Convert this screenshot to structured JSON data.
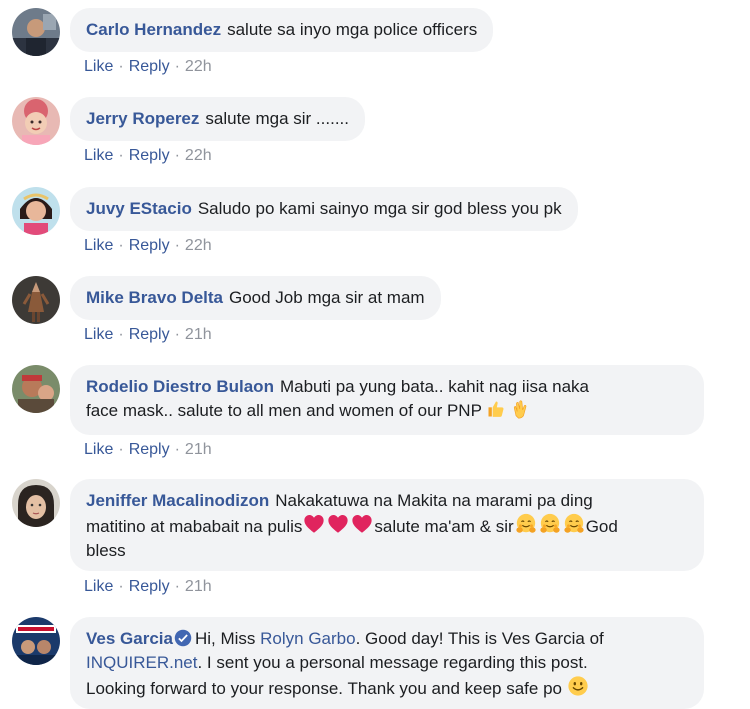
{
  "comments": [
    {
      "name": "Carlo Hernandez",
      "text": "salute sa inyo mga police officers",
      "like": "Like",
      "reply": "Reply",
      "time": "22h"
    },
    {
      "name": "Jerry Roperez",
      "text": "salute mga sir .......",
      "like": "Like",
      "reply": "Reply",
      "time": "22h"
    },
    {
      "name": "Juvy EStacio",
      "text": "Saludo po kami sainyo mga sir god bless you pk",
      "like": "Like",
      "reply": "Reply",
      "time": "22h"
    },
    {
      "name": "Mike Bravo Delta",
      "text": "Good Job mga sir at mam",
      "like": "Like",
      "reply": "Reply",
      "time": "21h"
    },
    {
      "name": "Rodelio Diestro Bulaon",
      "text_line1": "Mabuti pa yung bata.. kahit nag iisa naka",
      "text_line2": "face mask.. salute to all men and women of our PNP",
      "emojis": [
        "thumbs-up-icon",
        "clapping-hands-icon"
      ],
      "like": "Like",
      "reply": "Reply",
      "time": "21h"
    },
    {
      "name": "Jeniffer Macalinodizon",
      "text_line1": "Nakakatuwa na Makita na marami pa ding",
      "text_line2a": "matitino at mababait na pulis",
      "text_line2b": "salute ma'am & sir",
      "text_line2c": "God",
      "text_line3": "bless",
      "emojis": [
        "red-heart-icon",
        "hugging-face-icon"
      ],
      "like": "Like",
      "reply": "Reply",
      "time": "21h"
    },
    {
      "name": "Ves Garcia",
      "verified": true,
      "text_a": "Hi, Miss ",
      "mention": "Rolyn Garbo",
      "text_b": ". Good day! This is Ves Garcia of",
      "link": "INQUIRER.net",
      "text_c": ". I sent you a personal message regarding this post.",
      "text_d": "Looking forward to your response. Thank you and keep safe po",
      "emojis": [
        "smiling-face-icon"
      ]
    }
  ],
  "colors": {
    "name": "#385898",
    "bubble": "#f2f3f5",
    "text": "#1c1e21",
    "time": "#90949c"
  }
}
